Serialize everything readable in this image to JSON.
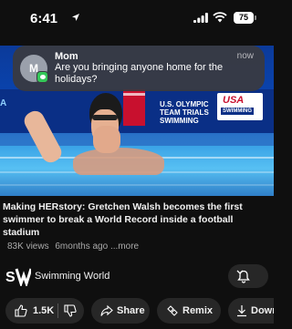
{
  "status_bar": {
    "time": "6:41",
    "battery": "75"
  },
  "notification": {
    "avatar_initial": "M",
    "sender": "Mom",
    "time": "now",
    "message": "Are you bringing anyone home for the holidays?"
  },
  "video": {
    "title": "Making HERstory: Gretchen Walsh becomes the first swimmer to break a World Record inside a football stadium",
    "views": "83K views",
    "age": "6months ago",
    "more": "...more"
  },
  "channel": {
    "name": "Swimming World"
  },
  "actions": {
    "likes": "1.5K",
    "share": "Share",
    "remix": "Remix",
    "download": "Download"
  },
  "background_signage": {
    "trials": "U.S. OLYMPIC TEAM TRIALS SWIMMING",
    "usa": "USA",
    "usa_sub": "SWIMMING",
    "left_edge": "A"
  },
  "colors": {
    "notification_badge": "#34c759",
    "sponsor_red": "#c8102e",
    "sponsor_blue": "#0a2f86"
  }
}
